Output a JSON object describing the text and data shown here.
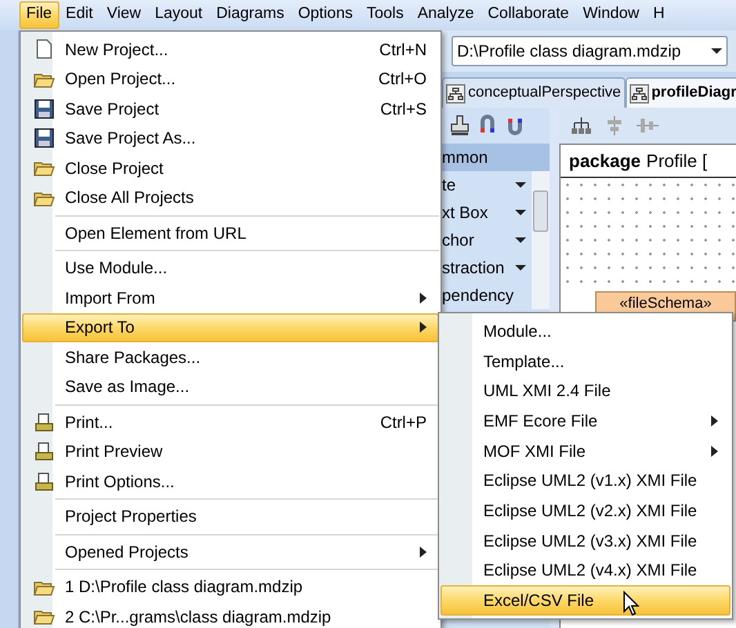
{
  "menubar": [
    {
      "label": "File",
      "selected": true
    },
    {
      "label": "Edit",
      "selected": false
    },
    {
      "label": "View",
      "selected": false
    },
    {
      "label": "Layout",
      "selected": false
    },
    {
      "label": "Diagrams",
      "selected": false
    },
    {
      "label": "Options",
      "selected": false
    },
    {
      "label": "Tools",
      "selected": false
    },
    {
      "label": "Analyze",
      "selected": false
    },
    {
      "label": "Collaborate",
      "selected": false
    },
    {
      "label": "Window",
      "selected": false
    },
    {
      "label": "H",
      "selected": false
    }
  ],
  "project_combo": {
    "value": "D:\\Profile class diagram.mdzip"
  },
  "tabs": [
    {
      "label": "conceptualPerspective",
      "selected": false
    },
    {
      "label": "profileDiagr",
      "selected": true
    }
  ],
  "palette": {
    "header": "mmon",
    "items": [
      "te",
      "xt Box",
      "chor",
      "straction",
      "pendency"
    ]
  },
  "diagram": {
    "keyword": "package",
    "name": "Profile [",
    "element": "«fileSchema»"
  },
  "file_menu": {
    "groups": [
      [
        {
          "label": "New Project...",
          "shortcut": "Ctrl+N",
          "selected": false,
          "submenu": false
        },
        {
          "label": "Open Project...",
          "shortcut": "Ctrl+O",
          "selected": false,
          "submenu": false
        },
        {
          "label": "Save Project",
          "shortcut": "Ctrl+S",
          "selected": false,
          "submenu": false
        },
        {
          "label": "Save Project As...",
          "selected": false,
          "submenu": false
        },
        {
          "label": "Close Project",
          "selected": false,
          "submenu": false
        },
        {
          "label": "Close All Projects",
          "selected": false,
          "submenu": false
        }
      ],
      [
        {
          "label": "Open Element from URL",
          "selected": false,
          "submenu": false
        }
      ],
      [
        {
          "label": "Use Module...",
          "selected": false,
          "submenu": false
        },
        {
          "label": "Import From",
          "selected": false,
          "submenu": true
        },
        {
          "label": "Export To",
          "selected": true,
          "submenu": true
        },
        {
          "label": "Share Packages...",
          "selected": false,
          "submenu": false
        },
        {
          "label": "Save as Image...",
          "selected": false,
          "submenu": false
        }
      ],
      [
        {
          "label": "Print...",
          "shortcut": "Ctrl+P",
          "selected": false,
          "submenu": false
        },
        {
          "label": "Print Preview",
          "selected": false,
          "submenu": false
        },
        {
          "label": "Print Options...",
          "selected": false,
          "submenu": false
        }
      ],
      [
        {
          "label": "Project Properties",
          "selected": false,
          "submenu": false
        }
      ],
      [
        {
          "label": "Opened Projects",
          "selected": false,
          "submenu": true
        }
      ],
      [
        {
          "label": "1 D:\\Profile class diagram.mdzip",
          "selected": false,
          "submenu": false
        },
        {
          "label": "2 C:\\Pr...grams\\class diagram.mdzip",
          "selected": false,
          "submenu": false
        }
      ]
    ]
  },
  "export_menu": {
    "items": [
      {
        "label": "Module...",
        "selected": false,
        "submenu": false
      },
      {
        "label": "Template...",
        "selected": false,
        "submenu": false
      },
      {
        "label": "UML XMI 2.4 File",
        "selected": false,
        "submenu": false
      },
      {
        "label": "EMF Ecore File",
        "selected": false,
        "submenu": true
      },
      {
        "label": "MOF XMI File",
        "selected": false,
        "submenu": true
      },
      {
        "label": "Eclipse UML2 (v1.x) XMI File",
        "selected": false,
        "submenu": false
      },
      {
        "label": "Eclipse UML2 (v2.x) XMI File",
        "selected": false,
        "submenu": false
      },
      {
        "label": "Eclipse UML2 (v3.x) XMI File",
        "selected": false,
        "submenu": false
      },
      {
        "label": "Eclipse UML2 (v4.x) XMI File",
        "selected": false,
        "submenu": false
      },
      {
        "label": "Excel/CSV File",
        "selected": true,
        "submenu": false
      }
    ]
  }
}
